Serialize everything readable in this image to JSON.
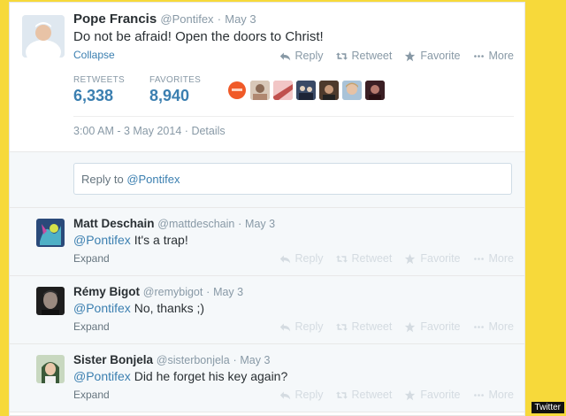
{
  "main_tweet": {
    "name": "Pope Francis",
    "handle": "@Pontifex",
    "separator": "·",
    "date": "May 3",
    "text": "Do not be afraid! Open the doors to Christ!",
    "collapse_label": "Collapse",
    "actions": {
      "reply": "Reply",
      "retweet": "Retweet",
      "favorite": "Favorite",
      "more": "More"
    },
    "stats": {
      "retweets_label": "RETWEETS",
      "retweets": "6,338",
      "favorites_label": "FAVORITES",
      "favorites": "8,940"
    },
    "timestamp": "3:00 AM - 3 May 2014",
    "details_sep": "·",
    "details_label": "Details"
  },
  "reply_box": {
    "prefix": "Reply to ",
    "mention": "@Pontifex"
  },
  "replies": [
    {
      "name": "Matt Deschain",
      "handle": "@mattdeschain",
      "separator": "·",
      "date": "May 3",
      "mention": "@Pontifex",
      "text": " It's a trap!",
      "expand": "Expand"
    },
    {
      "name": "Rémy Bigot",
      "handle": "@remybigot",
      "separator": "·",
      "date": "May 3",
      "mention": "@Pontifex",
      "text": " No, thanks ;)",
      "expand": "Expand"
    },
    {
      "name": "Sister Bonjela",
      "handle": "@sisterbonjela",
      "separator": "·",
      "date": "May 3",
      "mention": "@Pontifex",
      "text": " Did he forget his key again?",
      "expand": "Expand"
    }
  ],
  "reply_actions": {
    "reply": "Reply",
    "retweet": "Retweet",
    "favorite": "Favorite",
    "more": "More"
  },
  "credit": "Twitter",
  "colors": {
    "link": "#3b7fb0",
    "background": "#f7d93a",
    "muted": "#8899a6"
  }
}
